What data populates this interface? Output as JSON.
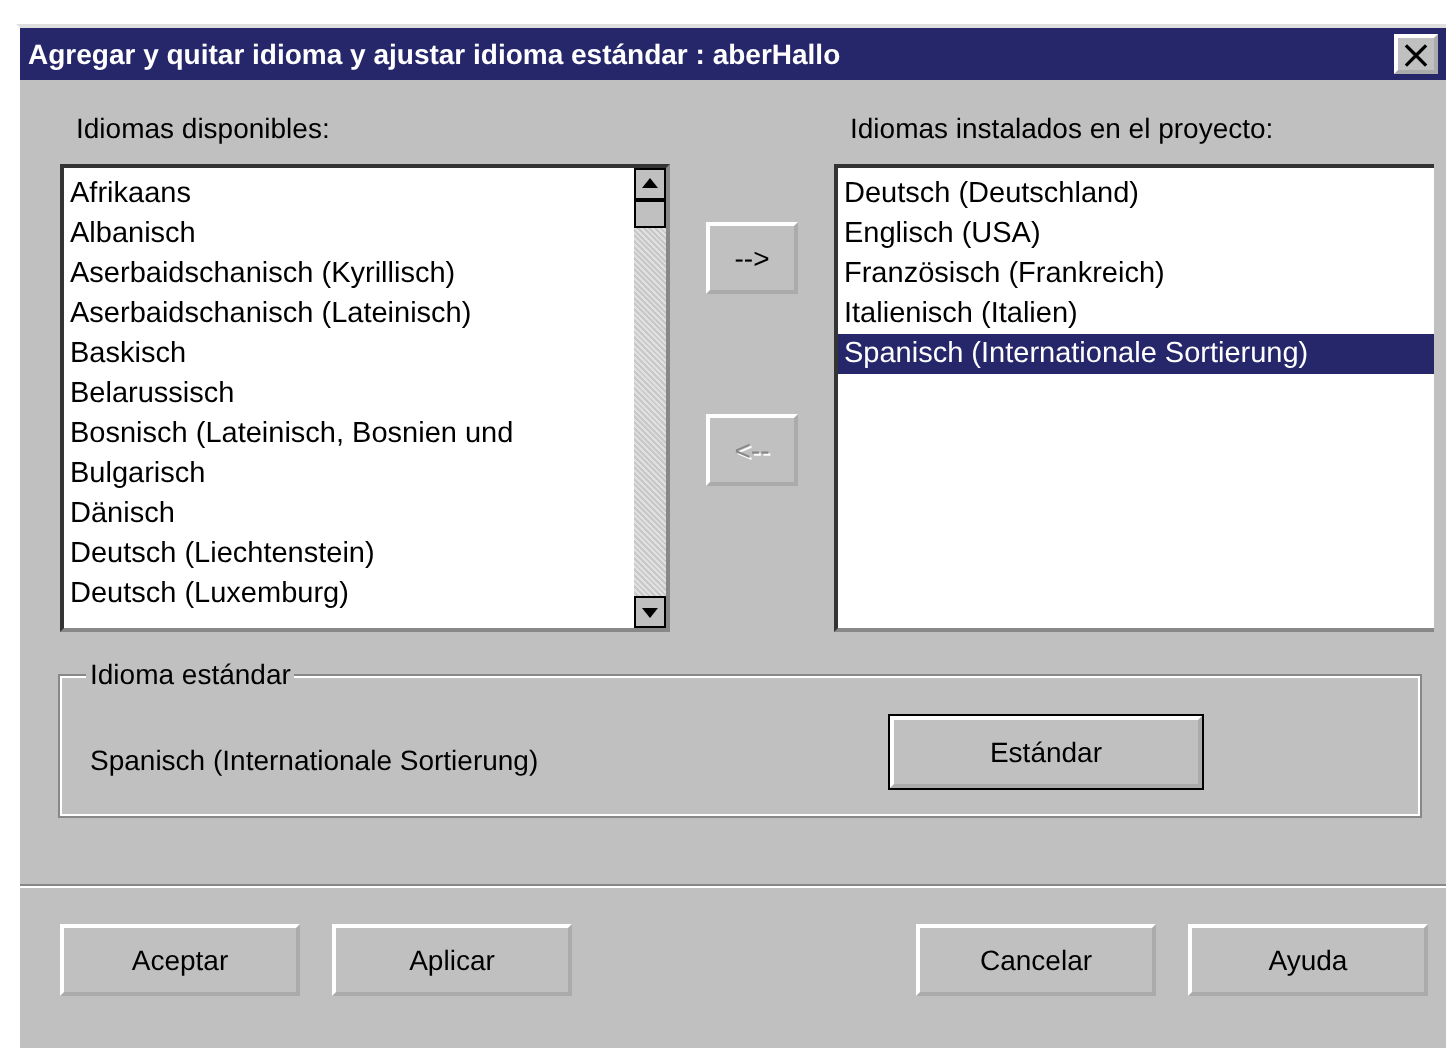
{
  "window": {
    "title": "Agregar y quitar idioma y ajustar idioma estándar : aberHallo",
    "close": "×"
  },
  "available": {
    "label": "Idiomas disponibles:",
    "items": [
      {
        "text": "Afrikaans",
        "selected": false
      },
      {
        "text": "Albanisch",
        "selected": false
      },
      {
        "text": "Aserbaidschanisch (Kyrillisch)",
        "selected": false
      },
      {
        "text": "Aserbaidschanisch (Lateinisch)",
        "selected": false
      },
      {
        "text": "Baskisch",
        "selected": false
      },
      {
        "text": "Belarussisch",
        "selected": false
      },
      {
        "text": "Bosnisch (Lateinisch, Bosnien und",
        "selected": false
      },
      {
        "text": "Bulgarisch",
        "selected": false
      },
      {
        "text": "Dänisch",
        "selected": false
      },
      {
        "text": "Deutsch (Liechtenstein)",
        "selected": false
      },
      {
        "text": "Deutsch (Luxemburg)",
        "selected": false
      }
    ]
  },
  "move_buttons": [
    {
      "label": "-->",
      "disabled": false
    },
    {
      "label": "<--",
      "disabled": true
    }
  ],
  "installed": {
    "label": "Idiomas instalados en el proyecto:",
    "items": [
      {
        "text": "Deutsch (Deutschland)",
        "selected": false
      },
      {
        "text": "Englisch (USA)",
        "selected": false
      },
      {
        "text": "Französisch (Frankreich)",
        "selected": false
      },
      {
        "text": "Italienisch (Italien)",
        "selected": false
      },
      {
        "text": "Spanisch (Internationale Sortierung)",
        "selected": true
      }
    ]
  },
  "standard": {
    "legend": "Idioma estándar",
    "value": "Spanisch (Internationale Sortierung)",
    "button": {
      "label": "Estándar",
      "default": true
    }
  },
  "buttons": [
    {
      "label": "Aceptar",
      "disabled": false
    },
    {
      "label": "Aplicar",
      "disabled": false
    },
    {
      "label": "Cancelar",
      "disabled": false
    },
    {
      "label": "Ayuda",
      "disabled": false
    }
  ]
}
